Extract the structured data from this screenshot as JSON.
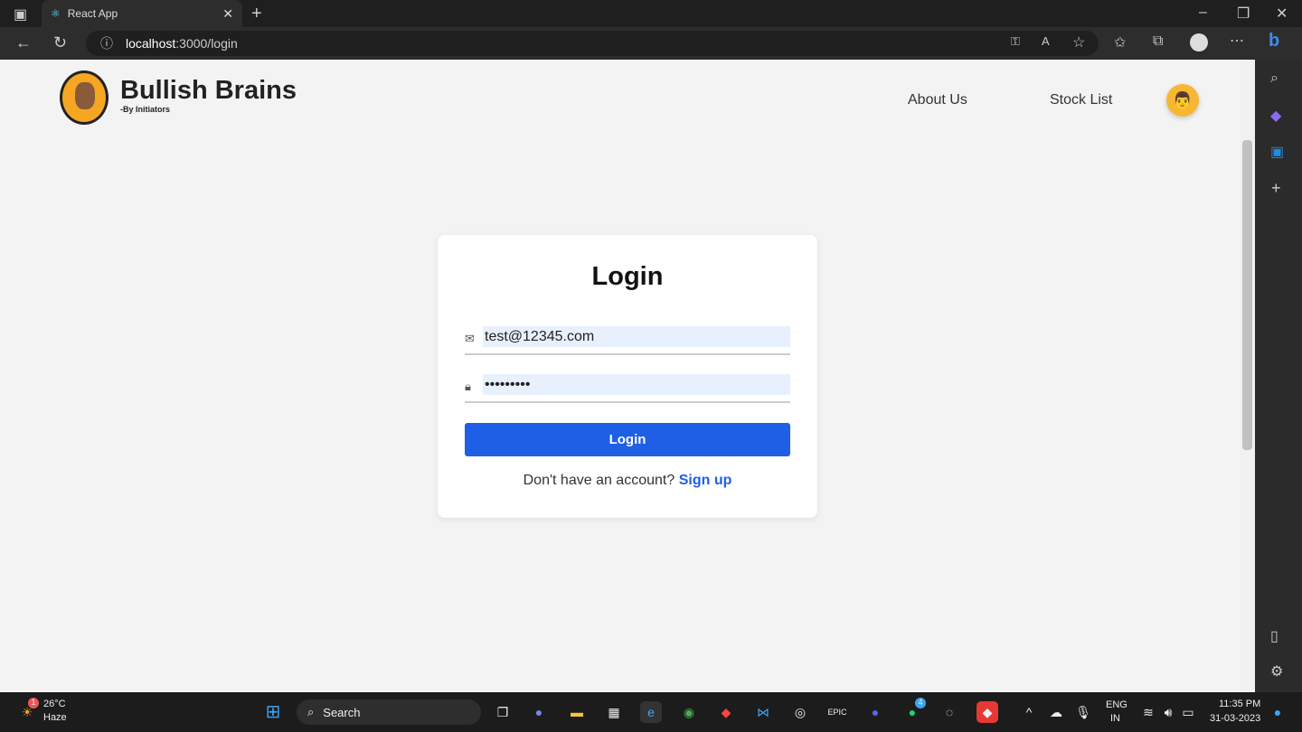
{
  "browser": {
    "tab_title": "React App",
    "url_host": "localhost",
    "url_path": ":3000/login",
    "icons": [
      "sidebar-icon",
      "react-icon",
      "close-icon",
      "plus-icon",
      "back-icon",
      "refresh-icon",
      "info-icon",
      "key-icon",
      "read-aloud-icon",
      "add-favorite-icon",
      "favorites-icon",
      "collections-icon",
      "profile-icon",
      "more-icon",
      "bing-icon"
    ]
  },
  "header": {
    "brand": "Bullish Brains",
    "tagline": "-By Initiators",
    "nav": [
      "About Us",
      "Stock List"
    ],
    "avatar_icon": "user-avatar"
  },
  "login": {
    "title": "Login",
    "email_value": "test@12345.com",
    "password_value": "•••••••••",
    "button": "Login",
    "prompt": "Don't have an account?",
    "signup": "Sign up",
    "accent": "#1f5fe6"
  },
  "taskbar": {
    "weather_temp": "26°C",
    "weather_desc": "Haze",
    "weather_badge": "1",
    "search": "Search",
    "lang1": "ENG",
    "lang2": "IN",
    "time": "11:35 PM",
    "date": "31-03-2023",
    "whatsapp_badge": "4"
  }
}
